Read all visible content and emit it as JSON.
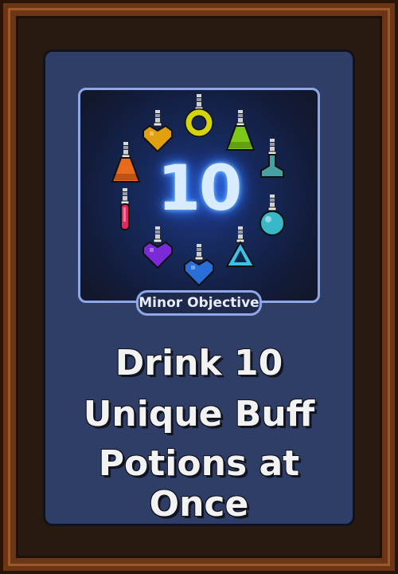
{
  "objective": {
    "count": "10",
    "badge_label": "Minor Objective",
    "title_lines": [
      "Drink 10",
      "Unique Buff",
      "Potions at Once"
    ]
  },
  "potions": [
    {
      "name": "yellow-ring-potion-icon",
      "color": "#d4d40e"
    },
    {
      "name": "lime-flask-potion-icon",
      "color": "#7ec81a"
    },
    {
      "name": "teal-bottle-potion-icon",
      "color": "#4aa0a0"
    },
    {
      "name": "cyan-round-potion-icon",
      "color": "#38b8c8"
    },
    {
      "name": "aqua-triangle-potion-icon",
      "color": "#40c0e8"
    },
    {
      "name": "blue-heart-potion-icon",
      "color": "#2a6ed8"
    },
    {
      "name": "purple-heart-potion-icon",
      "color": "#7a2ad8"
    },
    {
      "name": "red-vial-potion-icon",
      "color": "#e02860"
    },
    {
      "name": "orange-flask-potion-icon",
      "color": "#e86a1c"
    },
    {
      "name": "gold-heart-potion-icon",
      "color": "#e0a010"
    }
  ],
  "colors": {
    "card_bg": "#2f3e66",
    "panel_border": "#8fa7e6",
    "number_glow": "#7fc6ff",
    "frame_wood": "#6b3616"
  }
}
